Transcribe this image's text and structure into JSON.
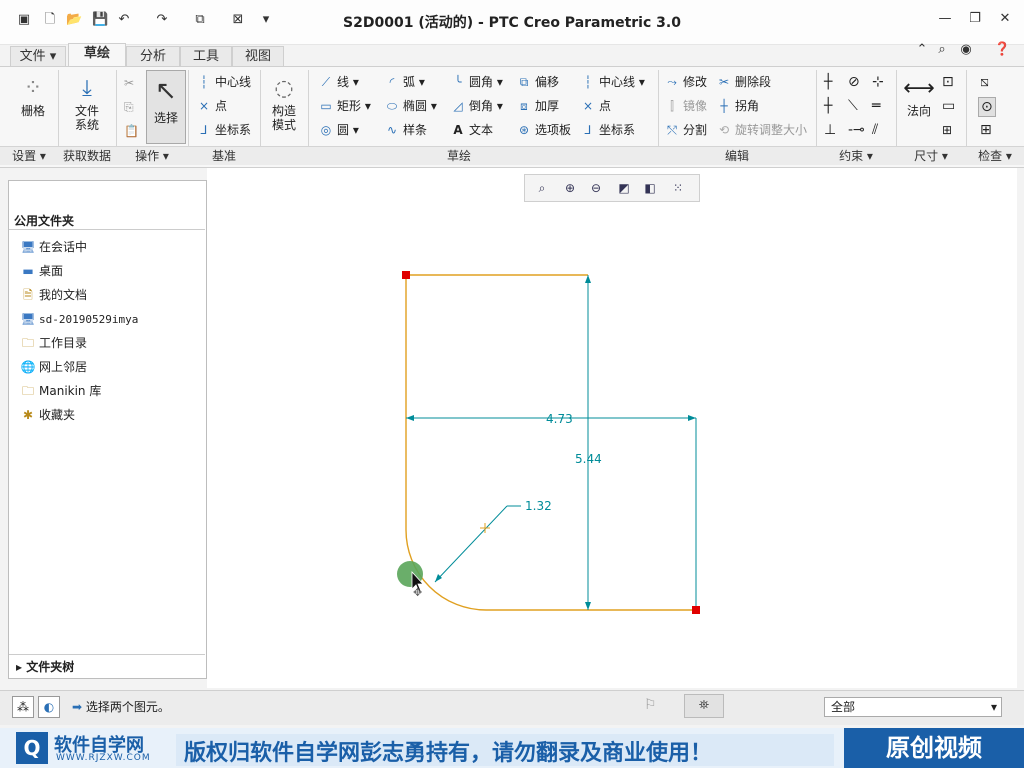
{
  "window": {
    "title": "S2D0001 (活动的) - PTC Creo Parametric 3.0"
  },
  "tabs": [
    {
      "label": "文件"
    },
    {
      "label": "草绘"
    },
    {
      "label": "分析"
    },
    {
      "label": "工具"
    },
    {
      "label": "视图"
    }
  ],
  "ribbon": {
    "setup": {
      "grid": "栅格",
      "group": "设置"
    },
    "get_data": {
      "file_system": "文件系统",
      "group": "获取数据"
    },
    "operations": {
      "select": "选择",
      "group": "操作"
    },
    "datum": {
      "centerline": "中心线",
      "point": "点",
      "csys": "坐标系",
      "group": "基准"
    },
    "construction": {
      "label": "构造模式"
    },
    "sketch": {
      "line": "线",
      "arc": "弧",
      "fillet": "圆角",
      "offset": "偏移",
      "rectangle": "矩形",
      "ellipse": "椭圆",
      "chamfer": "倒角",
      "thicken": "加厚",
      "circle": "圆",
      "spline": "样条",
      "text": "文本",
      "palette": "选项板",
      "centerline": "中心线",
      "point": "点",
      "csys": "坐标系",
      "group": "草绘"
    },
    "edit": {
      "modify": "修改",
      "delete_segment": "删除段",
      "mirror": "镜像",
      "corner": "拐角",
      "divide": "分割",
      "rotate_resize": "旋转调整大小",
      "group": "编辑"
    },
    "constrain": {
      "group": "约束"
    },
    "dimension": {
      "normal": "法向",
      "group": "尺寸"
    },
    "inspect": {
      "group": "检查"
    }
  },
  "folders": {
    "header": "公用文件夹",
    "items": [
      "在会话中",
      "桌面",
      "我的文档",
      "sd-20190529imya",
      "工作目录",
      "网上邻居",
      "Manikin 库",
      "收藏夹"
    ],
    "tree": "文件夹树"
  },
  "sketch": {
    "dim_width": "4.73",
    "dim_height": "5.44",
    "dim_radius": "1.32"
  },
  "status": {
    "message": "选择两个图元。",
    "filter": "全部"
  },
  "banner": {
    "logo": "软件自学网",
    "logo_url": "WWW.RJZXW.COM",
    "notice": "版权归软件自学网彭志勇持有，请勿翻录及商业使用！",
    "badge": "原创视频"
  },
  "colors": {
    "curve": "#e0a020",
    "dimension": "#008c99",
    "point": "#e00000",
    "highlight": "#5aa55a",
    "banner_blue": "#1a5fa8"
  }
}
